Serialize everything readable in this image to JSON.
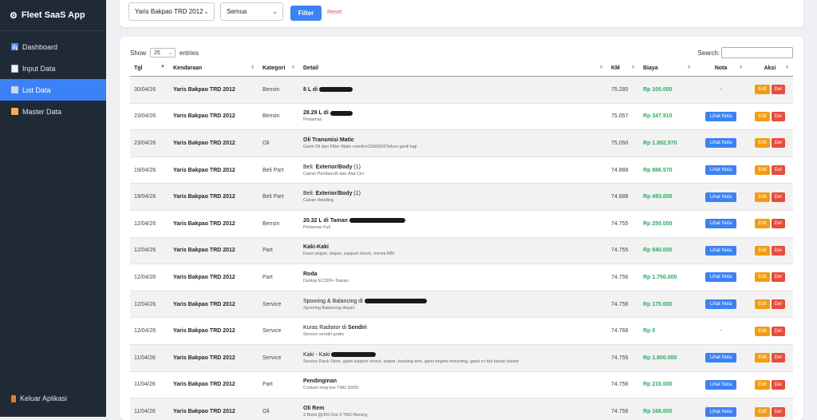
{
  "app": {
    "title": "Fleet SaaS App"
  },
  "sidebar": {
    "items": [
      {
        "label": "Dashboard",
        "icon": "chart-icon",
        "active": false
      },
      {
        "label": "Input Data",
        "icon": "document-icon",
        "active": false
      },
      {
        "label": "List Data",
        "icon": "list-icon",
        "active": true
      },
      {
        "label": "Master Data",
        "icon": "folder-icon",
        "active": false
      }
    ],
    "logout_label": "Keluar Aplikasi"
  },
  "filter": {
    "vehicle_value": "Yaris Bakpao TRD 2012",
    "category_value": "Semua",
    "filter_label": "Filter",
    "reset_label": "Reset"
  },
  "table": {
    "show_label": "Show",
    "entries_value": "25",
    "entries_label": "entries",
    "search_label": "Search:",
    "headers": [
      "Tgl",
      "Kendaraan",
      "Kategori",
      "Detail",
      "KM",
      "Biaya",
      "Nota",
      "Aksi"
    ],
    "nota_button_label": "Lihat Nota",
    "edit_label": "Edit",
    "del_label": "Del",
    "rows": [
      {
        "tgl": "30/04/26",
        "vehicle": "Yaris Bakpao TRD 2012",
        "category": "Bensin",
        "detail_pre": "",
        "detail_bold": "8 L di",
        "detail_post": "",
        "mask": 42,
        "sub": "",
        "km": "75.280",
        "cost": "Rp 100.000",
        "nota": "-"
      },
      {
        "tgl": "23/04/26",
        "vehicle": "Yaris Bakpao TRD 2012",
        "category": "Bensin",
        "detail_pre": "",
        "detail_bold": "28.29 L di",
        "detail_post": "",
        "mask": 28,
        "sub": "Pertamax",
        "km": "75.057",
        "cost": "Rp 347.910",
        "nota": "btn"
      },
      {
        "tgl": "23/04/26",
        "vehicle": "Yaris Bakpao TRD 2012",
        "category": "Oli",
        "detail_pre": "",
        "detail_bold": "Oli Transmisi Matic",
        "detail_post": "",
        "mask": 0,
        "sub": "Ganti Oli dan Filter Matic noteKm155000/5Tahun ganti lagi",
        "km": "75.050",
        "cost": "Rp 1.892.970",
        "nota": "btn"
      },
      {
        "tgl": "19/04/26",
        "vehicle": "Yaris Bakpao TRD 2012",
        "category": "Beli Part",
        "detail_pre": "Beli: ",
        "detail_bold": "Exterior/Body",
        "detail_post": " (1)",
        "mask": 0,
        "sub": "Cairan Pembersih dan Alat Cici",
        "km": "74.888",
        "cost": "Rp 886.570",
        "nota": "btn"
      },
      {
        "tgl": "19/04/26",
        "vehicle": "Yaris Bakpao TRD 2012",
        "category": "Beli Part",
        "detail_pre": "Beli: ",
        "detail_bold": "Exterior/Body",
        "detail_post": " (1)",
        "mask": 0,
        "sub": "Cairan detailing",
        "km": "74.888",
        "cost": "Rp 493.000",
        "nota": "btn"
      },
      {
        "tgl": "12/04/26",
        "vehicle": "Yaris Bakpao TRD 2012",
        "category": "Bensin",
        "detail_pre": "",
        "detail_bold": "20.32 L di Taman",
        "detail_post": "",
        "mask": 70,
        "sub": "Pertamax Full",
        "km": "74.755",
        "cost": "Rp 250.000",
        "nota": "btn"
      },
      {
        "tgl": "12/04/26",
        "vehicle": "Yaris Bakpao TRD 2012",
        "category": "Part",
        "detail_pre": "",
        "detail_bold": "Kaki-Kaki",
        "detail_post": "",
        "mask": 0,
        "sub": "Karet stoper, stoper, support shock, merek RBI",
        "km": "74.755",
        "cost": "Rp 940.000",
        "nota": "btn"
      },
      {
        "tgl": "12/04/26",
        "vehicle": "Yaris Bakpao TRD 2012",
        "category": "Part",
        "detail_pre": "",
        "detail_bold": "Roda",
        "detail_post": "",
        "mask": 0,
        "sub": "Dunlop EC300+ Depan",
        "km": "74.756",
        "cost": "Rp 1.750.000",
        "nota": "btn"
      },
      {
        "tgl": "12/04/26",
        "vehicle": "Yaris Bakpao TRD 2012",
        "category": "Service",
        "detail_pre": "Spooring & Balancing di ",
        "detail_bold": "",
        "detail_post": "",
        "mask": 78,
        "sub": "Spooring Balancing depan",
        "km": "74.756",
        "cost": "Rp 175.000",
        "nota": "btn"
      },
      {
        "tgl": "12/04/26",
        "vehicle": "Yaris Bakpao TRD 2012",
        "category": "Service",
        "detail_pre": "Kuras Radiator di ",
        "detail_bold": "Sendiri",
        "detail_post": "",
        "mask": 0,
        "sub": "Service sendiri gratis",
        "km": "74.768",
        "cost": "Rp 0",
        "nota": "-"
      },
      {
        "tgl": "11/04/26",
        "vehicle": "Yaris Bakpao TRD 2012",
        "category": "Service",
        "detail_pre": "Kaki - Kaki ",
        "detail_bold": "",
        "detail_post": "",
        "mask": 56,
        "sub": "Service Rack Steer, ganti support shock, stoper, bushing arm, ganti engine mounting, ganti cv bot kanan dalam",
        "km": "74.755",
        "cost": "Rp 1.800.000",
        "nota": "btn"
      },
      {
        "tgl": "11/04/26",
        "vehicle": "Yaris Bakpao TRD 2012",
        "category": "Part",
        "detail_pre": "",
        "detail_bold": "Pendinginan",
        "detail_post": "",
        "mask": 0,
        "sub": "Coolant long live TMO 50/50",
        "km": "74.756",
        "cost": "Rp 210.000",
        "nota": "btn"
      },
      {
        "tgl": "11/04/26",
        "vehicle": "Yaris Bakpao TRD 2012",
        "category": "Oli",
        "detail_pre": "",
        "detail_bold": "Oli Rem",
        "detail_post": "",
        "mask": 0,
        "sub": "3 Botol @350 Dot 3 TMO Bening",
        "km": "74.756",
        "cost": "Rp 168.000",
        "nota": "btn"
      }
    ]
  }
}
